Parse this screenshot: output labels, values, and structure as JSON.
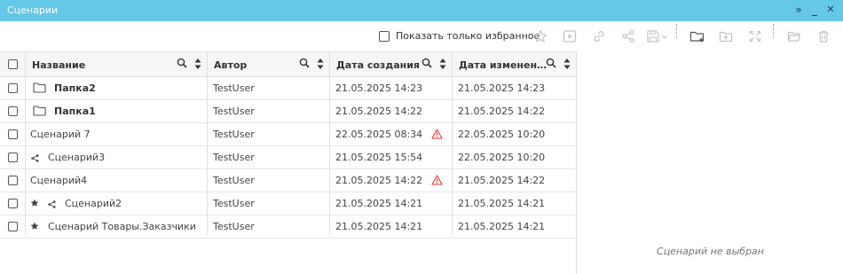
{
  "window": {
    "title": "Сценарии",
    "expand_icon": "»",
    "minimize_icon": "_",
    "close_icon": "✕"
  },
  "toolbar": {
    "favorites_label": "Показать только избранное",
    "favorites_checked": false
  },
  "table": {
    "columns": [
      {
        "label": "Название"
      },
      {
        "label": "Автор"
      },
      {
        "label": "Дата создания"
      },
      {
        "label": "Дата изменен…"
      }
    ],
    "rows": [
      {
        "type": "folder",
        "name": "Папка2",
        "author": "TestUser",
        "created": "21.05.2025 14:23",
        "modified": "21.05.2025 14:23",
        "warning": false,
        "favorite": false,
        "shared": false
      },
      {
        "type": "folder",
        "name": "Папка1",
        "author": "TestUser",
        "created": "21.05.2025 14:22",
        "modified": "21.05.2025 14:22",
        "warning": false,
        "favorite": false,
        "shared": false
      },
      {
        "type": "scenario",
        "name": "Сценарий 7",
        "author": "TestUser",
        "created": "22.05.2025 08:34",
        "modified": "22.05.2025 10:20",
        "warning": true,
        "favorite": false,
        "shared": false
      },
      {
        "type": "scenario",
        "name": "Сценарий3",
        "author": "TestUser",
        "created": "21.05.2025 15:54",
        "modified": "22.05.2025 10:20",
        "warning": false,
        "favorite": false,
        "shared": true
      },
      {
        "type": "scenario",
        "name": "Сценарий4",
        "author": "TestUser",
        "created": "21.05.2025 14:22",
        "modified": "21.05.2025 14:22",
        "warning": true,
        "favorite": false,
        "shared": false
      },
      {
        "type": "scenario",
        "name": "Сценарий2",
        "author": "TestUser",
        "created": "21.05.2025 14:21",
        "modified": "21.05.2025 14:21",
        "warning": false,
        "favorite": true,
        "shared": true
      },
      {
        "type": "scenario",
        "name": "Сценарий Товары.Заказчики",
        "author": "TestUser",
        "created": "21.05.2025 14:21",
        "modified": "21.05.2025 14:21",
        "warning": false,
        "favorite": true,
        "shared": false
      }
    ]
  },
  "detail": {
    "empty_message": "Сценарий не выбран"
  },
  "colors": {
    "titlebar": "#64c8e6",
    "warning": "#e53935",
    "icon_disabled": "#c4c4c4",
    "icon_active": "#555555"
  }
}
